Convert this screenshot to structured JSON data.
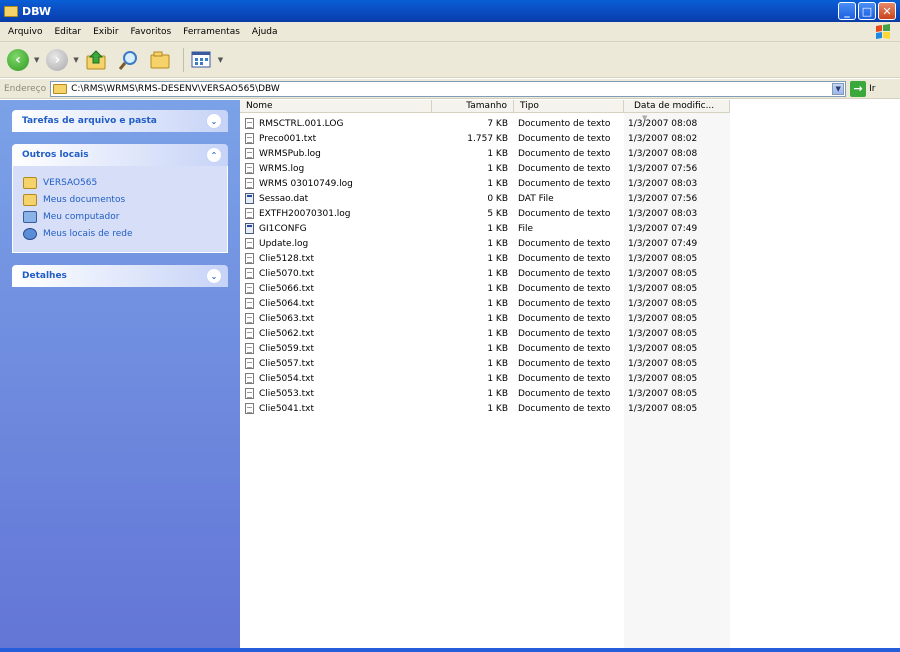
{
  "window": {
    "title": "DBW",
    "buttons": {
      "minimize": "_",
      "maximize": "□",
      "close": "✕"
    }
  },
  "menu": [
    "Arquivo",
    "Editar",
    "Exibir",
    "Favoritos",
    "Ferramentas",
    "Ajuda"
  ],
  "address": {
    "label": "Endereço",
    "path": "C:\\RMS\\WRMS\\RMS-DESENV\\VERSAO565\\DBW",
    "go_label": "Ir"
  },
  "left_pane": {
    "tasks": {
      "title": "Tarefas de arquivo e pasta"
    },
    "other": {
      "title": "Outros locais",
      "items": [
        "VERSAO565",
        "Meus documentos",
        "Meu computador",
        "Meus locais de rede"
      ]
    },
    "details": {
      "title": "Detalhes"
    }
  },
  "columns": {
    "name": "Nome",
    "size": "Tamanho",
    "type": "Tipo",
    "date": "Data de modific..."
  },
  "files": [
    {
      "name": "RMSCTRL.001.LOG",
      "size": "7 KB",
      "type": "Documento de texto",
      "date": "1/3/2007 08:08",
      "icon": "text-file-icon"
    },
    {
      "name": "Preco001.txt",
      "size": "1.757 KB",
      "type": "Documento de texto",
      "date": "1/3/2007 08:02",
      "icon": "text-file-icon"
    },
    {
      "name": "WRMSPub.log",
      "size": "1 KB",
      "type": "Documento de texto",
      "date": "1/3/2007 08:08",
      "icon": "text-file-icon"
    },
    {
      "name": "WRMS.log",
      "size": "1 KB",
      "type": "Documento de texto",
      "date": "1/3/2007 07:56",
      "icon": "text-file-icon"
    },
    {
      "name": "WRMS 03010749.log",
      "size": "1 KB",
      "type": "Documento de texto",
      "date": "1/3/2007 08:03",
      "icon": "text-file-icon"
    },
    {
      "name": "Sessao.dat",
      "size": "0 KB",
      "type": "DAT File",
      "date": "1/3/2007 07:56",
      "icon": "generic-file-icon"
    },
    {
      "name": "EXTFH20070301.log",
      "size": "5 KB",
      "type": "Documento de texto",
      "date": "1/3/2007 08:03",
      "icon": "text-file-icon"
    },
    {
      "name": "GI1CONFG",
      "size": "1 KB",
      "type": "File",
      "date": "1/3/2007 07:49",
      "icon": "generic-file-icon"
    },
    {
      "name": "Update.log",
      "size": "1 KB",
      "type": "Documento de texto",
      "date": "1/3/2007 07:49",
      "icon": "text-file-icon"
    },
    {
      "name": "Clie5128.txt",
      "size": "1 KB",
      "type": "Documento de texto",
      "date": "1/3/2007 08:05",
      "icon": "text-file-icon"
    },
    {
      "name": "Clie5070.txt",
      "size": "1 KB",
      "type": "Documento de texto",
      "date": "1/3/2007 08:05",
      "icon": "text-file-icon"
    },
    {
      "name": "Clie5066.txt",
      "size": "1 KB",
      "type": "Documento de texto",
      "date": "1/3/2007 08:05",
      "icon": "text-file-icon"
    },
    {
      "name": "Clie5064.txt",
      "size": "1 KB",
      "type": "Documento de texto",
      "date": "1/3/2007 08:05",
      "icon": "text-file-icon"
    },
    {
      "name": "Clie5063.txt",
      "size": "1 KB",
      "type": "Documento de texto",
      "date": "1/3/2007 08:05",
      "icon": "text-file-icon"
    },
    {
      "name": "Clie5062.txt",
      "size": "1 KB",
      "type": "Documento de texto",
      "date": "1/3/2007 08:05",
      "icon": "text-file-icon"
    },
    {
      "name": "Clie5059.txt",
      "size": "1 KB",
      "type": "Documento de texto",
      "date": "1/3/2007 08:05",
      "icon": "text-file-icon"
    },
    {
      "name": "Clie5057.txt",
      "size": "1 KB",
      "type": "Documento de texto",
      "date": "1/3/2007 08:05",
      "icon": "text-file-icon"
    },
    {
      "name": "Clie5054.txt",
      "size": "1 KB",
      "type": "Documento de texto",
      "date": "1/3/2007 08:05",
      "icon": "text-file-icon"
    },
    {
      "name": "Clie5053.txt",
      "size": "1 KB",
      "type": "Documento de texto",
      "date": "1/3/2007 08:05",
      "icon": "text-file-icon"
    },
    {
      "name": "Clie5041.txt",
      "size": "1 KB",
      "type": "Documento de texto",
      "date": "1/3/2007 08:05",
      "icon": "text-file-icon"
    }
  ]
}
